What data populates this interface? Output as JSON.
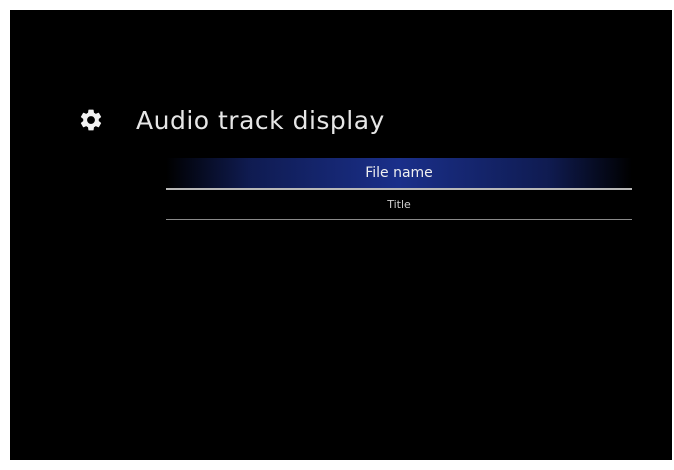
{
  "header": {
    "icon": "gear-icon",
    "title": "Audio track display"
  },
  "menu": {
    "items": [
      {
        "label": "File name",
        "selected": true
      },
      {
        "label": "Title",
        "selected": false
      }
    ]
  },
  "colors": {
    "background": "#000000",
    "highlight": "#1a2f8a",
    "text": "#e6e6e6"
  }
}
